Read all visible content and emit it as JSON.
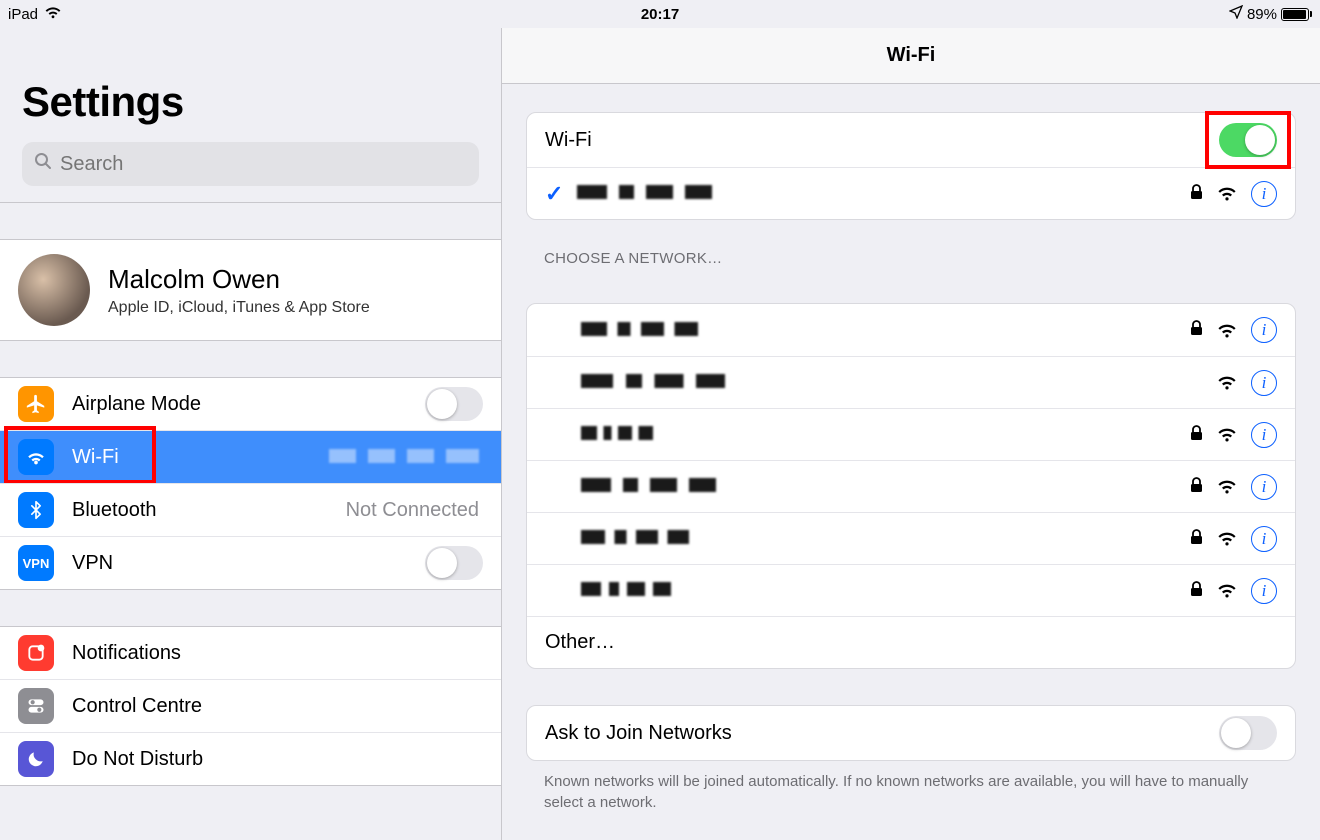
{
  "statusbar": {
    "device": "iPad",
    "time": "20:17",
    "battery_percent": "89%",
    "battery_fill_pct": 89
  },
  "sidebar": {
    "title": "Settings",
    "search_placeholder": "Search",
    "account": {
      "name": "Malcolm Owen",
      "subtitle": "Apple ID, iCloud, iTunes & App Store"
    },
    "group_network": {
      "airplane": {
        "label": "Airplane Mode",
        "on": false
      },
      "wifi": {
        "label": "Wi-Fi",
        "value_redacted": true,
        "selected": true
      },
      "bluetooth": {
        "label": "Bluetooth",
        "value": "Not Connected"
      },
      "vpn": {
        "label": "VPN",
        "on": false
      }
    },
    "group_general": {
      "notifications": {
        "label": "Notifications"
      },
      "control_centre": {
        "label": "Control Centre"
      },
      "dnd": {
        "label": "Do Not Disturb"
      }
    }
  },
  "detail": {
    "title": "Wi-Fi",
    "wifi_switch": {
      "label": "Wi-Fi",
      "on": true
    },
    "connected": {
      "ssid_redacted": true,
      "locked": true
    },
    "choose_header": "Choose a Network…",
    "networks": [
      {
        "ssid_redacted": true,
        "locked": true
      },
      {
        "ssid_redacted": true,
        "locked": false
      },
      {
        "ssid_redacted": true,
        "locked": true
      },
      {
        "ssid_redacted": true,
        "locked": true
      },
      {
        "ssid_redacted": true,
        "locked": true
      },
      {
        "ssid_redacted": true,
        "locked": true
      }
    ],
    "other_label": "Other…",
    "ask_to_join": {
      "label": "Ask to Join Networks",
      "on": false
    },
    "footer": "Known networks will be joined automatically. If no known networks are available, you will have to manually select a network."
  }
}
